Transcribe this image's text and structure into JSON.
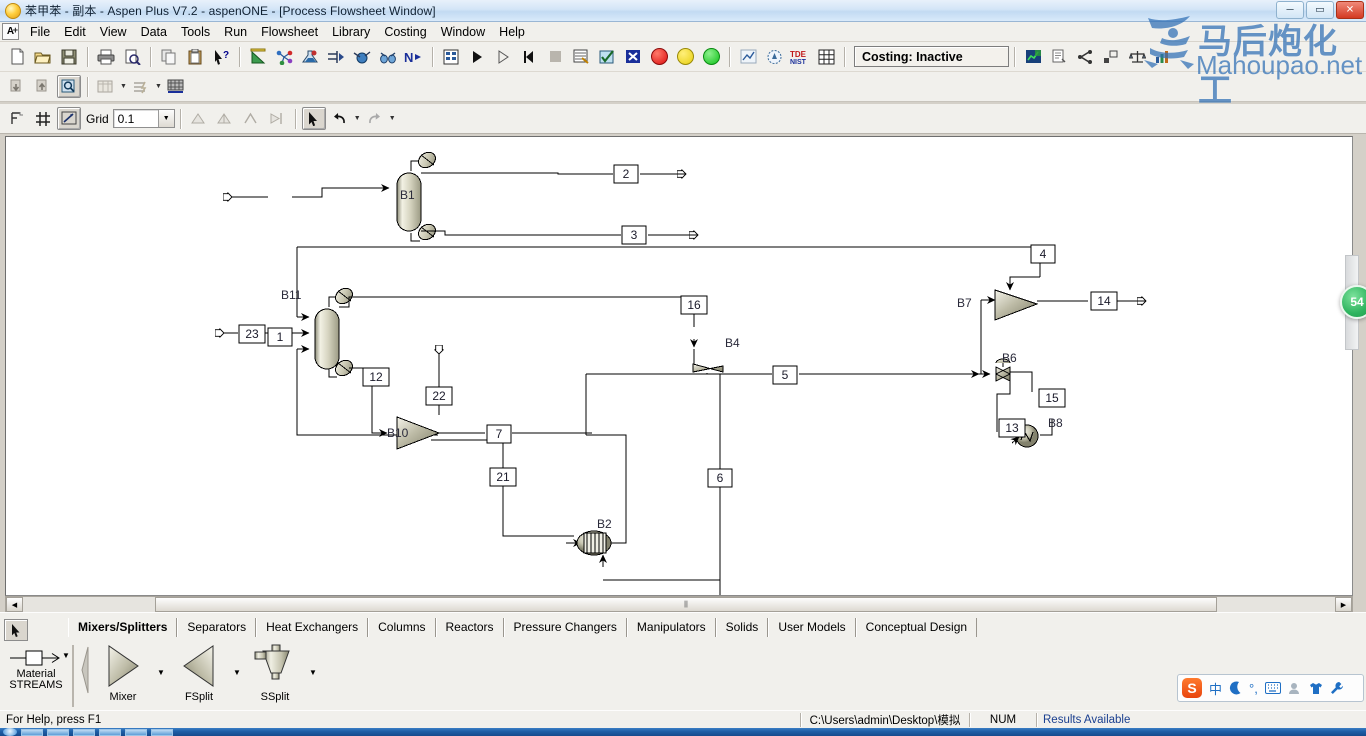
{
  "window": {
    "title": "苯甲苯 - 副本 - Aspen Plus V7.2 - aspenONE - [Process Flowsheet Window]",
    "app_icon": "aspen-orb-icon",
    "buttons": {
      "minimize": "─",
      "maximize": "▭",
      "close": "✕"
    }
  },
  "menu": {
    "items": [
      {
        "label": "File"
      },
      {
        "label": "Edit"
      },
      {
        "label": "View"
      },
      {
        "label": "Data"
      },
      {
        "label": "Tools"
      },
      {
        "label": "Run"
      },
      {
        "label": "Flowsheet"
      },
      {
        "label": "Library"
      },
      {
        "label": "Costing"
      },
      {
        "label": "Window"
      },
      {
        "label": "Help"
      }
    ]
  },
  "toolbar_main": {
    "groups": [
      {
        "buttons": [
          {
            "name": "new-icon",
            "glyph": "📄"
          },
          {
            "name": "open-folder-icon",
            "glyph": "📂"
          },
          {
            "name": "save-icon",
            "glyph": "💾"
          }
        ]
      },
      {
        "buttons": [
          {
            "name": "print-icon",
            "glyph": "🖨"
          },
          {
            "name": "print-preview-icon",
            "glyph": "🔍"
          }
        ]
      },
      {
        "buttons": [
          {
            "name": "copy-icon",
            "glyph": "⧉"
          },
          {
            "name": "paste-icon",
            "glyph": "📋"
          },
          {
            "name": "help-pointer-icon",
            "glyph": "?"
          }
        ]
      },
      {
        "buttons": [
          {
            "name": "properties-setup-icon",
            "glyph": "📐"
          },
          {
            "name": "components-icon",
            "glyph": "⚛"
          },
          {
            "name": "methods-icon",
            "glyph": "🧪"
          },
          {
            "name": "streams-icon",
            "glyph": "⇉"
          },
          {
            "name": "blocks-icon",
            "glyph": "⚙"
          },
          {
            "name": "binocular-icon",
            "glyph": "👓"
          },
          {
            "name": "next-n-icon",
            "glyph": "N→"
          }
        ]
      },
      {
        "buttons": [
          {
            "name": "control-panel-icon",
            "glyph": "▤"
          },
          {
            "name": "run-icon",
            "glyph": "▶"
          },
          {
            "name": "step-icon",
            "glyph": "▷"
          },
          {
            "name": "reinitialize-icon",
            "glyph": "◀|"
          },
          {
            "name": "stop-icon",
            "glyph": "■"
          },
          {
            "name": "results-icon",
            "glyph": "▥"
          },
          {
            "name": "input-check-icon",
            "glyph": "☑"
          },
          {
            "name": "reconcile-icon",
            "glyph": "✕"
          }
        ]
      },
      {
        "buttons": [
          {
            "name": "status-red-icon",
            "glyph": "●",
            "color": "#e01b1b"
          },
          {
            "name": "status-yellow-icon",
            "glyph": "●",
            "color": "#efd511"
          },
          {
            "name": "status-green-icon",
            "glyph": "●",
            "color": "#14c21e"
          }
        ]
      },
      {
        "buttons": [
          {
            "name": "analysis-icon",
            "glyph": "◐"
          },
          {
            "name": "pressure-relief-icon",
            "glyph": "⌬"
          },
          {
            "name": "tde-nist-icon",
            "glyph": "TDE"
          },
          {
            "name": "grid-table-icon",
            "glyph": "▦"
          }
        ]
      }
    ],
    "costing_status": "Costing: Inactive",
    "costing_buttons": [
      {
        "name": "activate-costing-icon",
        "glyph": "📊"
      },
      {
        "name": "cost-report-icon",
        "glyph": "🗎"
      },
      {
        "name": "map-icon",
        "glyph": "⋖"
      },
      {
        "name": "size-icon",
        "glyph": "▫"
      },
      {
        "name": "evaluate-icon",
        "glyph": "⚖"
      },
      {
        "name": "view-economics-icon",
        "glyph": "📈"
      }
    ]
  },
  "toolbar_secondary": {
    "buttons": [
      {
        "name": "import-icon",
        "glyph": "⬇"
      },
      {
        "name": "export-icon",
        "glyph": "⬆"
      },
      {
        "name": "zoom-icon",
        "glyph": "🔎"
      },
      {
        "name": "stream-table-icon",
        "glyph": "▤"
      },
      {
        "name": "stream-results-icon",
        "glyph": "⚡"
      },
      {
        "name": "heat-integration-icon",
        "glyph": "▩"
      }
    ]
  },
  "toolbar_flowsheet": {
    "buttons": [
      {
        "name": "global-data-icon",
        "glyph": "F"
      },
      {
        "name": "show-grid-icon",
        "glyph": "#"
      },
      {
        "name": "snap-to-grid-icon",
        "glyph": "◪"
      }
    ],
    "grid_label": "Grid",
    "grid_value": "0.1",
    "align_buttons": [
      {
        "name": "align-left-icon",
        "glyph": "◣"
      },
      {
        "name": "align-right-icon",
        "glyph": "◢"
      },
      {
        "name": "align-top-icon",
        "glyph": "◭"
      },
      {
        "name": "align-flip-icon",
        "glyph": "⊳"
      }
    ],
    "mode_buttons": [
      {
        "name": "select-arrow-icon",
        "glyph": "↖"
      },
      {
        "name": "undo-icon",
        "glyph": "↺"
      },
      {
        "name": "redo-icon",
        "glyph": "↻"
      }
    ]
  },
  "flowsheet": {
    "blocks": [
      {
        "id": "B1",
        "type": "radfrac-column",
        "label": "B1"
      },
      {
        "id": "B11",
        "type": "radfrac-column",
        "label": "B11"
      },
      {
        "id": "B7",
        "type": "mixer",
        "label": "B7"
      },
      {
        "id": "B6",
        "type": "valve",
        "label": "B6"
      },
      {
        "id": "B8",
        "type": "heat-exchanger",
        "label": "B8"
      },
      {
        "id": "B4",
        "type": "compressor",
        "label": "B4"
      },
      {
        "id": "B10",
        "type": "fsplit",
        "label": "B10"
      },
      {
        "id": "B2",
        "type": "reactor",
        "label": "B2"
      }
    ],
    "streams": [
      {
        "id": "1"
      },
      {
        "id": "2"
      },
      {
        "id": "3"
      },
      {
        "id": "4"
      },
      {
        "id": "5"
      },
      {
        "id": "6"
      },
      {
        "id": "7"
      },
      {
        "id": "12"
      },
      {
        "id": "13"
      },
      {
        "id": "14"
      },
      {
        "id": "15"
      },
      {
        "id": "16"
      },
      {
        "id": "21"
      },
      {
        "id": "22"
      },
      {
        "id": "23"
      }
    ]
  },
  "palette": {
    "select_tool": "select-arrow-icon",
    "streams": {
      "item_label": "Material",
      "group_label": "STREAMS"
    },
    "tabs": [
      {
        "label": "Mixers/Splitters",
        "active": true
      },
      {
        "label": "Separators",
        "active": false
      },
      {
        "label": "Heat Exchangers",
        "active": false
      },
      {
        "label": "Columns",
        "active": false
      },
      {
        "label": "Reactors",
        "active": false
      },
      {
        "label": "Pressure Changers",
        "active": false
      },
      {
        "label": "Manipulators",
        "active": false
      },
      {
        "label": "Solids",
        "active": false
      },
      {
        "label": "User Models",
        "active": false
      },
      {
        "label": "Conceptual Design",
        "active": false
      }
    ],
    "models": [
      {
        "label": "Mixer",
        "icon": "mixer-triangle-icon"
      },
      {
        "label": "FSplit",
        "icon": "fsplit-triangle-icon"
      },
      {
        "label": "SSplit",
        "icon": "ssplit-cyclone-icon"
      }
    ]
  },
  "statusbar": {
    "help": "For Help, press F1",
    "path": "C:\\Users\\admin\\Desktop\\模拟",
    "num": "NUM",
    "results": "Results Available"
  },
  "overlay": {
    "watermark_cn": "马后炮化工",
    "watermark_en": "Mahoupao.net",
    "badge_value": "54"
  },
  "ime": {
    "logo": "S",
    "items": [
      {
        "name": "ime-chinese-mode-icon",
        "glyph": "中"
      },
      {
        "name": "ime-moon-icon",
        "glyph": "🌙"
      },
      {
        "name": "ime-punctuation-icon",
        "glyph": "°,"
      },
      {
        "name": "ime-keyboard-icon",
        "glyph": "⌨"
      },
      {
        "name": "ime-user-icon",
        "glyph": "👤"
      },
      {
        "name": "ime-skin-icon",
        "glyph": "👕"
      },
      {
        "name": "ime-tools-icon",
        "glyph": "🔧"
      }
    ]
  }
}
